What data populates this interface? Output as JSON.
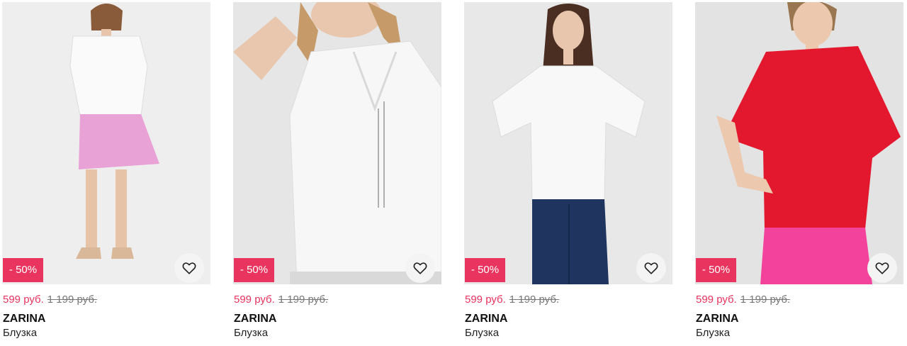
{
  "products": [
    {
      "discount": "- 50%",
      "price": "599 руб.",
      "old_price": "1 199 руб.",
      "brand": "ZARINA",
      "category": "Блузка",
      "colors": {
        "background": "#eeeeee",
        "top": "#fafafa",
        "bottom": "#e9a2d6"
      }
    },
    {
      "discount": "- 50%",
      "price": "599 руб.",
      "old_price": "1 199 руб.",
      "brand": "ZARINA",
      "category": "Блузка",
      "colors": {
        "background": "#e6e6e6",
        "top": "#f7f7f7",
        "bottom": "#d9d9d9"
      }
    },
    {
      "discount": "- 50%",
      "price": "599 руб.",
      "old_price": "1 199 руб.",
      "brand": "ZARINA",
      "category": "Блузка",
      "colors": {
        "background": "#e8e8e8",
        "top": "#f8f8f8",
        "bottom": "#1f3560"
      }
    },
    {
      "discount": "- 50%",
      "price": "599 руб.",
      "old_price": "1 199 руб.",
      "brand": "ZARINA",
      "category": "Блузка",
      "colors": {
        "background": "#e3e3e3",
        "top": "#e3182e",
        "bottom": "#f2429b"
      }
    }
  ],
  "icons": {
    "favorite": "heart-outline-icon"
  },
  "theme": {
    "accent": "#e8345e",
    "muted": "#777777"
  }
}
